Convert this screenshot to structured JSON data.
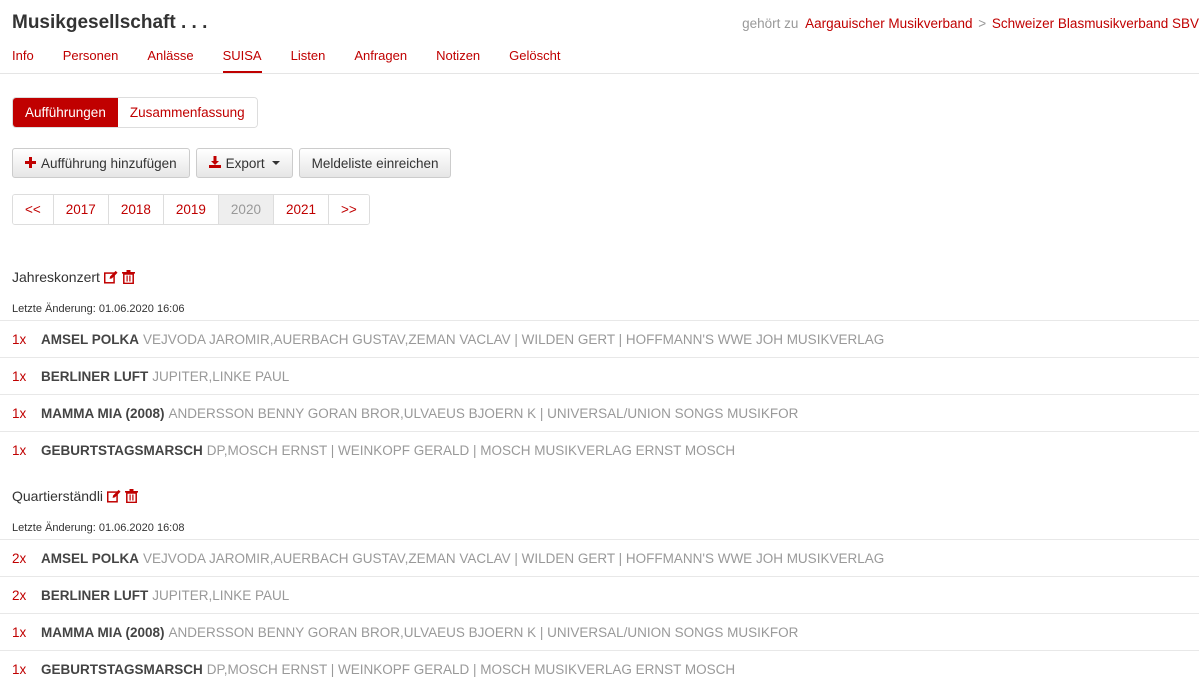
{
  "header": {
    "title": "Musikgesellschaft . . .",
    "belongs_to_label": "gehört zu",
    "parent_1": "Aargauischer Musikverband",
    "separator": ">",
    "parent_2": "Schweizer Blasmusikverband SBV"
  },
  "nav": {
    "tabs": [
      {
        "label": "Info"
      },
      {
        "label": "Personen"
      },
      {
        "label": "Anlässe"
      },
      {
        "label": "SUISA"
      },
      {
        "label": "Listen"
      },
      {
        "label": "Anfragen"
      },
      {
        "label": "Notizen"
      },
      {
        "label": "Gelöscht"
      }
    ],
    "active": "SUISA"
  },
  "toggle": {
    "performances": "Aufführungen",
    "summary": "Zusammenfassung"
  },
  "actions": {
    "add": "Aufführung hinzufügen",
    "export": "Export",
    "submit": "Meldeliste einreichen"
  },
  "pager": {
    "prev": "<<",
    "years": [
      "2017",
      "2018",
      "2019",
      "2020",
      "2021"
    ],
    "active_year": "2020",
    "next": ">>"
  },
  "events": [
    {
      "name": "Jahreskonzert",
      "changed": "Letzte Änderung: 01.06.2020 16:06",
      "items": [
        {
          "count": "1x",
          "title": "AMSEL POLKA",
          "details": "VEJVODA JAROMIR,AUERBACH GUSTAV,ZEMAN VACLAV | WILDEN GERT | HOFFMANN'S WWE JOH MUSIKVERLAG"
        },
        {
          "count": "1x",
          "title": "BERLINER LUFT",
          "details": "JUPITER,LINKE PAUL"
        },
        {
          "count": "1x",
          "title": "MAMMA MIA (2008)",
          "details": "ANDERSSON BENNY GORAN BROR,ULVAEUS BJOERN K | UNIVERSAL/UNION SONGS MUSIKFOR"
        },
        {
          "count": "1x",
          "title": "GEBURTSTAGSMARSCH",
          "details": "DP,MOSCH ERNST | WEINKOPF GERALD | MOSCH MUSIKVERLAG ERNST MOSCH"
        }
      ]
    },
    {
      "name": "Quartierständli",
      "changed": "Letzte Änderung: 01.06.2020 16:08",
      "items": [
        {
          "count": "2x",
          "title": "AMSEL POLKA",
          "details": "VEJVODA JAROMIR,AUERBACH GUSTAV,ZEMAN VACLAV | WILDEN GERT | HOFFMANN'S WWE JOH MUSIKVERLAG"
        },
        {
          "count": "2x",
          "title": "BERLINER LUFT",
          "details": "JUPITER,LINKE PAUL"
        },
        {
          "count": "1x",
          "title": "MAMMA MIA (2008)",
          "details": "ANDERSSON BENNY GORAN BROR,ULVAEUS BJOERN K | UNIVERSAL/UNION SONGS MUSIKFOR"
        },
        {
          "count": "1x",
          "title": "GEBURTSTAGSMARSCH",
          "details": "DP,MOSCH ERNST | WEINKOPF GERALD | MOSCH MUSIKVERLAG ERNST MOSCH"
        }
      ]
    }
  ],
  "colors": {
    "accent": "#c00000",
    "muted": "#999999"
  },
  "icons": [
    "plus-icon",
    "download-icon",
    "edit-icon",
    "trash-icon",
    "caret-down-icon"
  ]
}
